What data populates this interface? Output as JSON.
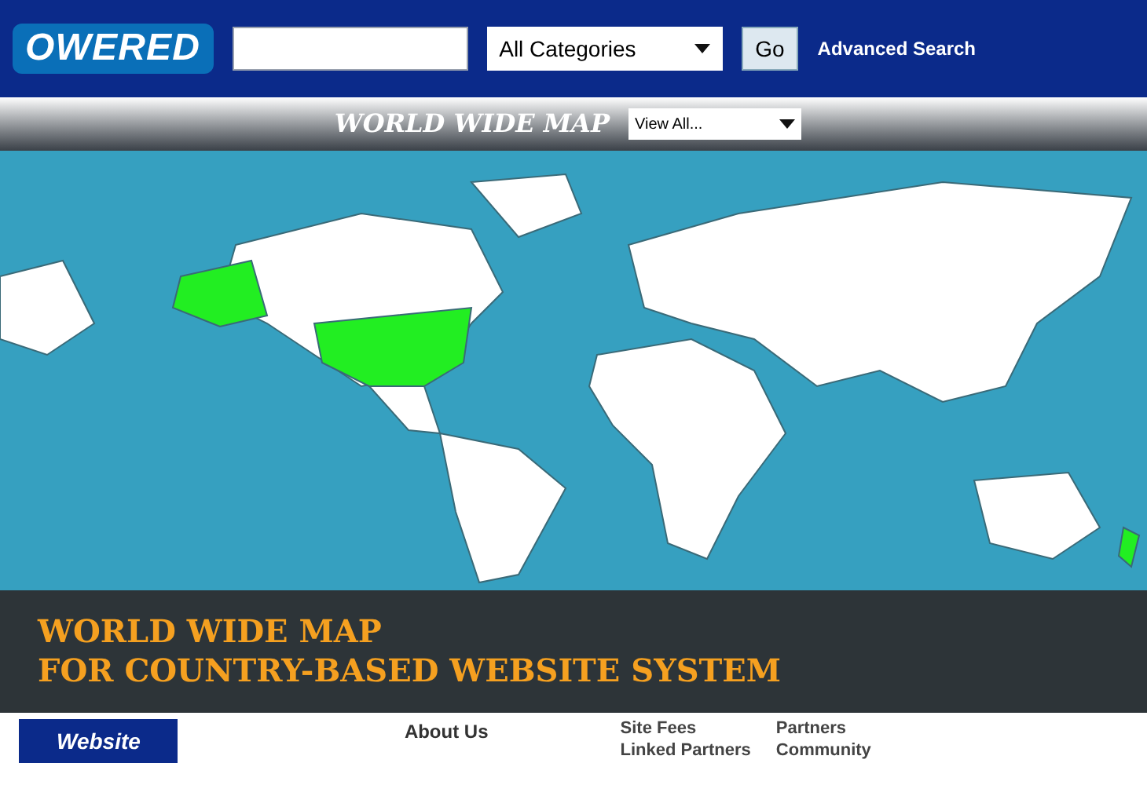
{
  "header": {
    "logo_text": "OWERED",
    "category_select": {
      "value": "All Categories"
    },
    "go_button": "Go",
    "advanced_search_link": "Advanced Search"
  },
  "map_panel": {
    "title": "WORLD WIDE MAP",
    "filter_select": {
      "value": "View All..."
    }
  },
  "caption": {
    "lines": [
      "WORLD WIDE MAP",
      "FOR COUNTRY-BASED WEBSITE SYSTEM"
    ]
  },
  "footer": {
    "banner": "Website",
    "about_link": "About Us",
    "links": [
      "Site Fees",
      "Partners",
      "Linked Partners",
      "Community"
    ]
  }
}
